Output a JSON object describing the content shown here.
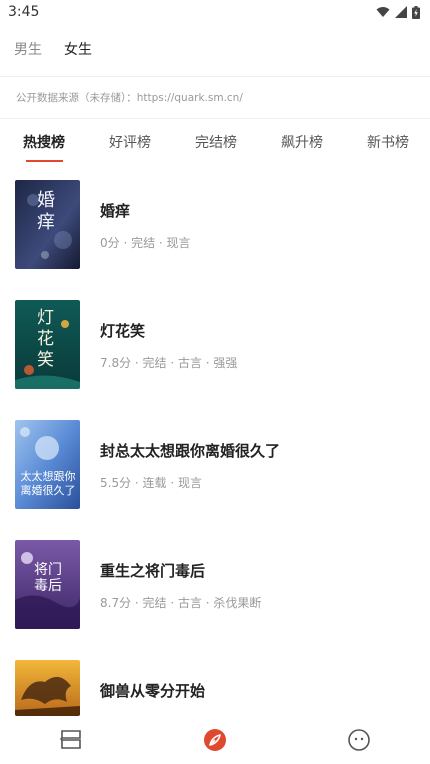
{
  "status_bar": {
    "time": "3:45"
  },
  "gender_tabs": [
    {
      "label": "男生",
      "active": false
    },
    {
      "label": "女生",
      "active": true
    }
  ],
  "source_note": "公开数据来源（未存储）：https://quark.sm.cn/",
  "rank_tabs": [
    {
      "label": "热搜榜",
      "active": true
    },
    {
      "label": "好评榜",
      "active": false
    },
    {
      "label": "完结榜",
      "active": false
    },
    {
      "label": "飙升榜",
      "active": false
    },
    {
      "label": "新书榜",
      "active": false
    }
  ],
  "books": [
    {
      "title": "婚痒",
      "meta": "0分 · 完结 · 现言",
      "cover_text": "婚痒"
    },
    {
      "title": "灯花笑",
      "meta": "7.8分 · 完结 · 古言 · 强强",
      "cover_text": "灯花笑"
    },
    {
      "title": "封总太太想跟你离婚很久了",
      "meta": "5.5分 · 连载 · 现言",
      "cover_text": "太太想跟你离婚很久了"
    },
    {
      "title": "重生之将门毒后",
      "meta": "8.7分 · 完结 · 古言 · 杀伐果断",
      "cover_text": "将门毒后"
    },
    {
      "title": "御兽从零分开始",
      "meta": "",
      "cover_text": ""
    }
  ],
  "colors": {
    "accent": "#e0482f",
    "text_primary": "#222222",
    "text_secondary": "#9a9a9a"
  },
  "bottom_nav": [
    {
      "icon": "bookshelf-icon"
    },
    {
      "icon": "feather-icon"
    },
    {
      "icon": "smiley-icon"
    }
  ]
}
